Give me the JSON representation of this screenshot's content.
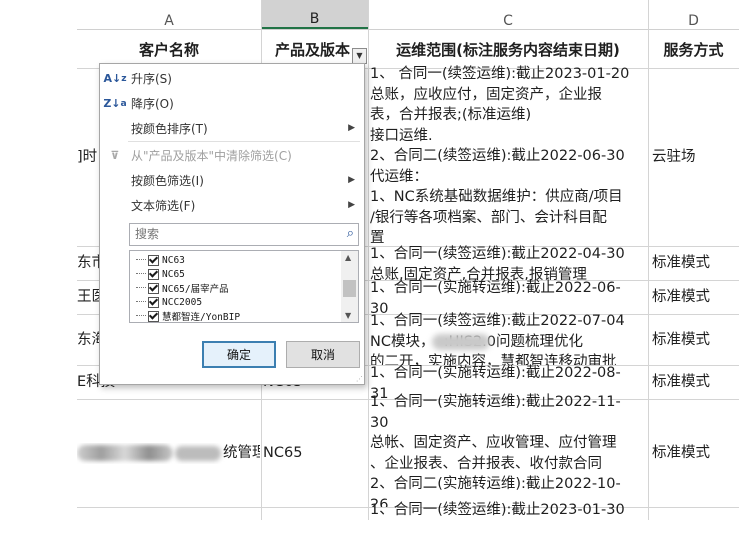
{
  "column_letters": [
    "A",
    "B",
    "C",
    "D"
  ],
  "headers": {
    "customer": "客户名称",
    "product": "产品及版本",
    "scope": "运维范围(标注服务内容结束日期)",
    "service": "服务方式"
  },
  "rows": [
    {
      "customer": "]时",
      "product": "",
      "scope": "1、 合同一(续签运维):截止2023-01-20\n总账，应收应付，固定资产，企业报\n表，合并报表;(标准运维)\n接口运维.\n2、合同二(续签运维):截止2022-06-30\n代运维：\n1、NC系统基础数据维护：供应商/项目\n/银行等各项档案、部门、会计科目配\n置",
      "service": "云驻场"
    },
    {
      "customer": "东市",
      "product": "",
      "scope": "1、合同一(续签运维):截止2022-04-30\n总账,固定资产,合并报表,报销管理",
      "service": "标准模式"
    },
    {
      "customer": "王医",
      "product": "",
      "scope": "1、合同一(实施转运维):截止2022-06-\n30",
      "service": "标准模式"
    },
    {
      "customer": "东海",
      "product": "",
      "scope": "1、合同一(续签运维):截止2022-07-04\nNC模块，  :HIS2.0问题梳理优化\n的二开，实施内容，慧都智连移动审批",
      "service": "标准模式"
    },
    {
      "customer": "E科技",
      "product": "NC65",
      "scope": "1、合同一(实施转运维):截止2022-08-\n31",
      "service": "标准模式"
    },
    {
      "customer_suffix": "统管理有限",
      "product": "NC65",
      "scope": "1、合同一(实施转运维):截止2022-11-\n30\n总帐、固定资产、应收管理、应付管理\n、企业报表、合并报表、收付款合同\n2、合同二(实施转运维):截止2022-10-\n26",
      "service": "标准模式"
    },
    {
      "scope": "1、合同一(续签运维):截止2023-01-30"
    }
  ],
  "filter_menu": {
    "sort_asc": "升序(S)",
    "sort_desc": "降序(O)",
    "sort_by_color": "按颜色排序(T)",
    "clear_filter": "从\"产品及版本\"中清除筛选(C)",
    "filter_by_color": "按颜色筛选(I)",
    "text_filter": "文本筛选(F)",
    "search_placeholder": "搜索",
    "items": [
      "NC63",
      "NC65",
      "NC65/届宰产品",
      "NCC2005",
      "慧都智连/YonBIP"
    ],
    "ok": "确定",
    "cancel": "取消"
  },
  "icons": {
    "sort_asc": "sort-ascending-icon",
    "sort_desc": "sort-descending-icon",
    "clear_filter": "clear-filter-icon",
    "search": "search-icon"
  }
}
